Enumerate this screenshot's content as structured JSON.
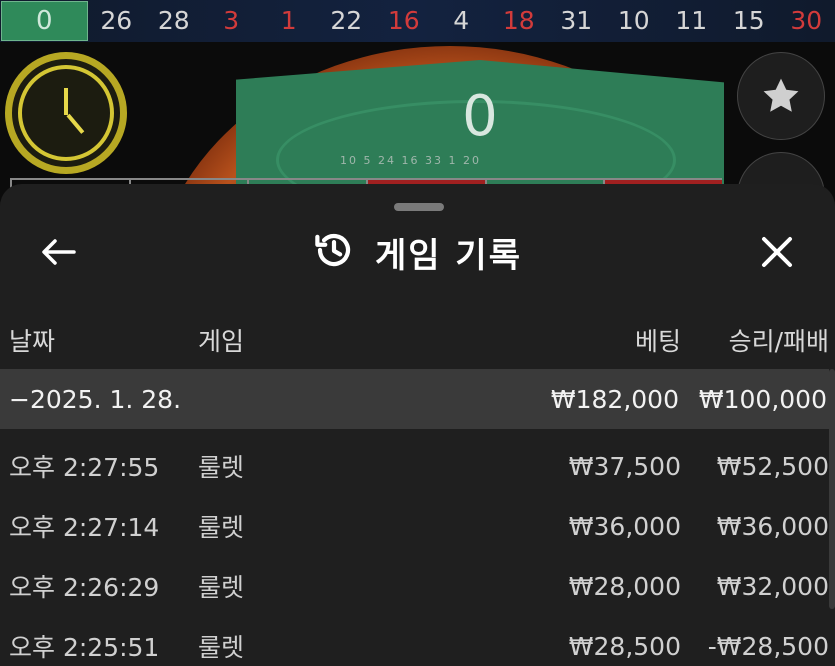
{
  "history": {
    "zero": "0",
    "numbers": [
      {
        "value": "26",
        "color": "black"
      },
      {
        "value": "28",
        "color": "black"
      },
      {
        "value": "3",
        "color": "red"
      },
      {
        "value": "1",
        "color": "red"
      },
      {
        "value": "22",
        "color": "black"
      },
      {
        "value": "16",
        "color": "red"
      },
      {
        "value": "4",
        "color": "black"
      },
      {
        "value": "18",
        "color": "red"
      },
      {
        "value": "31",
        "color": "black"
      },
      {
        "value": "10",
        "color": "black"
      },
      {
        "value": "11",
        "color": "black"
      },
      {
        "value": "15",
        "color": "black"
      },
      {
        "value": "30",
        "color": "red"
      }
    ],
    "colors": {
      "red": "#d23b3b",
      "black": "#d6d6d6",
      "zero_bg": "#2f8a5a"
    }
  },
  "game": {
    "result_display": "0",
    "wheel_numbers": "10 5 24 16 33 1 20",
    "timer_icon": "clock-icon",
    "favorite_icon": "star-icon",
    "second_button_glyph": "+"
  },
  "sheet": {
    "title": "게임 기록",
    "title_icon": "history-icon",
    "back_icon": "arrow-left-icon",
    "close_icon": "close-icon",
    "columns": {
      "date": "날짜",
      "game": "게임",
      "bet": "베팅",
      "win_loss": "승리/패배"
    },
    "date_group": {
      "label": "−2025. 1. 28.",
      "bet_total": "₩182,000",
      "win_total": "₩100,000"
    },
    "rows": [
      {
        "time": "오후 2:27:55",
        "game": "룰렛",
        "bet": "₩37,500",
        "result": "₩52,500"
      },
      {
        "time": "오후 2:27:14",
        "game": "룰렛",
        "bet": "₩36,000",
        "result": "₩36,000"
      },
      {
        "time": "오후 2:26:29",
        "game": "룰렛",
        "bet": "₩28,000",
        "result": "₩32,000"
      },
      {
        "time": "오후 2:25:51",
        "game": "룰렛",
        "bet": "₩28,500",
        "result": "-₩28,500"
      }
    ]
  }
}
